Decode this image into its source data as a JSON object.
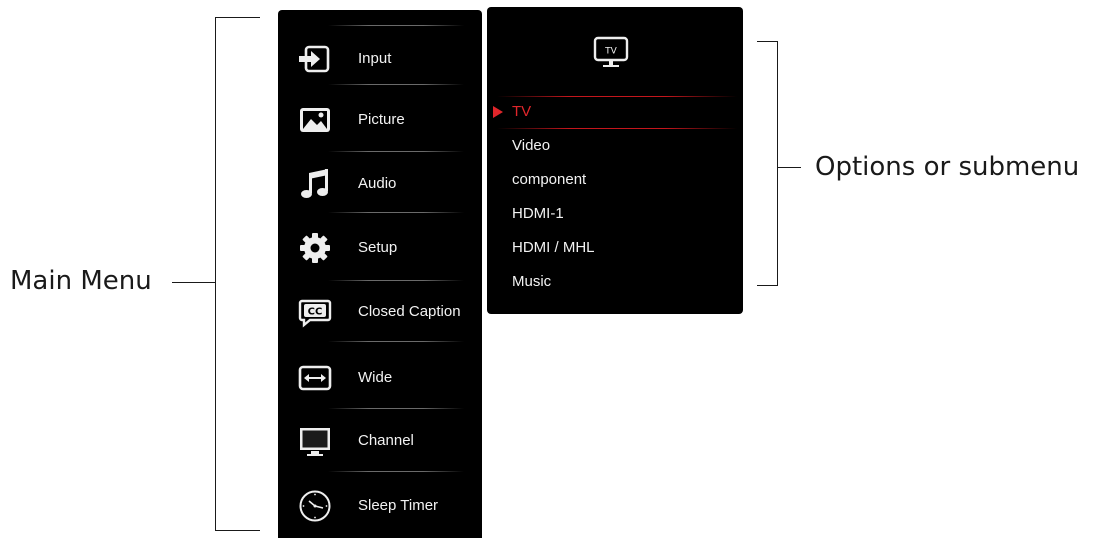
{
  "annotations": {
    "main_menu_label": "Main Menu",
    "options_label": "Options or submenu"
  },
  "main_menu": {
    "items": [
      {
        "label": "Input",
        "icon": "input-icon"
      },
      {
        "label": "Picture",
        "icon": "picture-icon"
      },
      {
        "label": "Audio",
        "icon": "audio-icon"
      },
      {
        "label": "Setup",
        "icon": "gear-icon"
      },
      {
        "label": "Closed Caption",
        "icon": "closed-caption-icon"
      },
      {
        "label": "Wide",
        "icon": "wide-icon"
      },
      {
        "label": "Channel",
        "icon": "channel-icon"
      },
      {
        "label": "Sleep Timer",
        "icon": "clock-icon"
      }
    ]
  },
  "sub_menu": {
    "header_icon": "tv-icon",
    "header_icon_text": "TV",
    "selected_index": 0,
    "items": [
      {
        "label": "TV"
      },
      {
        "label": "Video"
      },
      {
        "label": "component"
      },
      {
        "label": "HDMI-1"
      },
      {
        "label": "HDMI / MHL"
      },
      {
        "label": "Music"
      }
    ]
  },
  "colors": {
    "panel": "#000000",
    "text": "#f2f2f2",
    "accent": "#e0262b"
  }
}
